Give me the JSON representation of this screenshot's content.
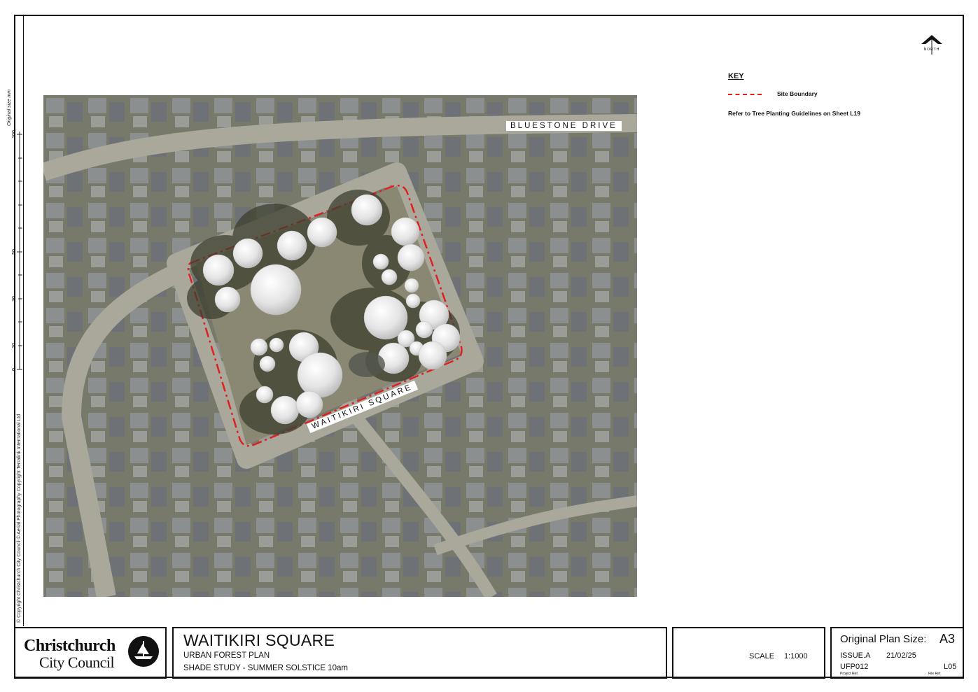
{
  "sidebar": {
    "copyright": "© Copyright Christchurch City Council  © Aerial Photography Copyright Terralink International Ltd",
    "ruler_caption": "Original size mm",
    "ruler_ticks": [
      "0",
      "10",
      "30",
      "50",
      "100"
    ]
  },
  "map": {
    "streets": [
      "BLUESTONE DRIVE",
      "WAITIKIRI SQUARE"
    ],
    "colors": {
      "boundary": "#e02020",
      "tree": "#e8e8e8",
      "shadow": "#3d3f2f"
    }
  },
  "key": {
    "title": "KEY",
    "items": [
      {
        "label": "Site Boundary",
        "line": "dashed-red"
      }
    ],
    "note": "Refer to Tree Planting Guidelines on Sheet L19"
  },
  "north": {
    "label": "NORTH"
  },
  "title_block": {
    "logo_line1": "Christchurch",
    "logo_line2": "City Council",
    "title": "WAITIKIRI SQUARE",
    "subtitle1": "URBAN FOREST PLAN",
    "subtitle2": "SHADE STUDY - SUMMER SOLSTICE 10am",
    "scale_label": "SCALE",
    "scale_value": "1:1000",
    "plan_size_label": "Original Plan Size:",
    "plan_size_value": "A3",
    "issue": "ISSUE.A",
    "date": "21/02/25",
    "project_ref": "UFP012",
    "project_ref_caption": "Project Ref.",
    "file_ref": "L05",
    "file_ref_caption": "File Ref."
  }
}
